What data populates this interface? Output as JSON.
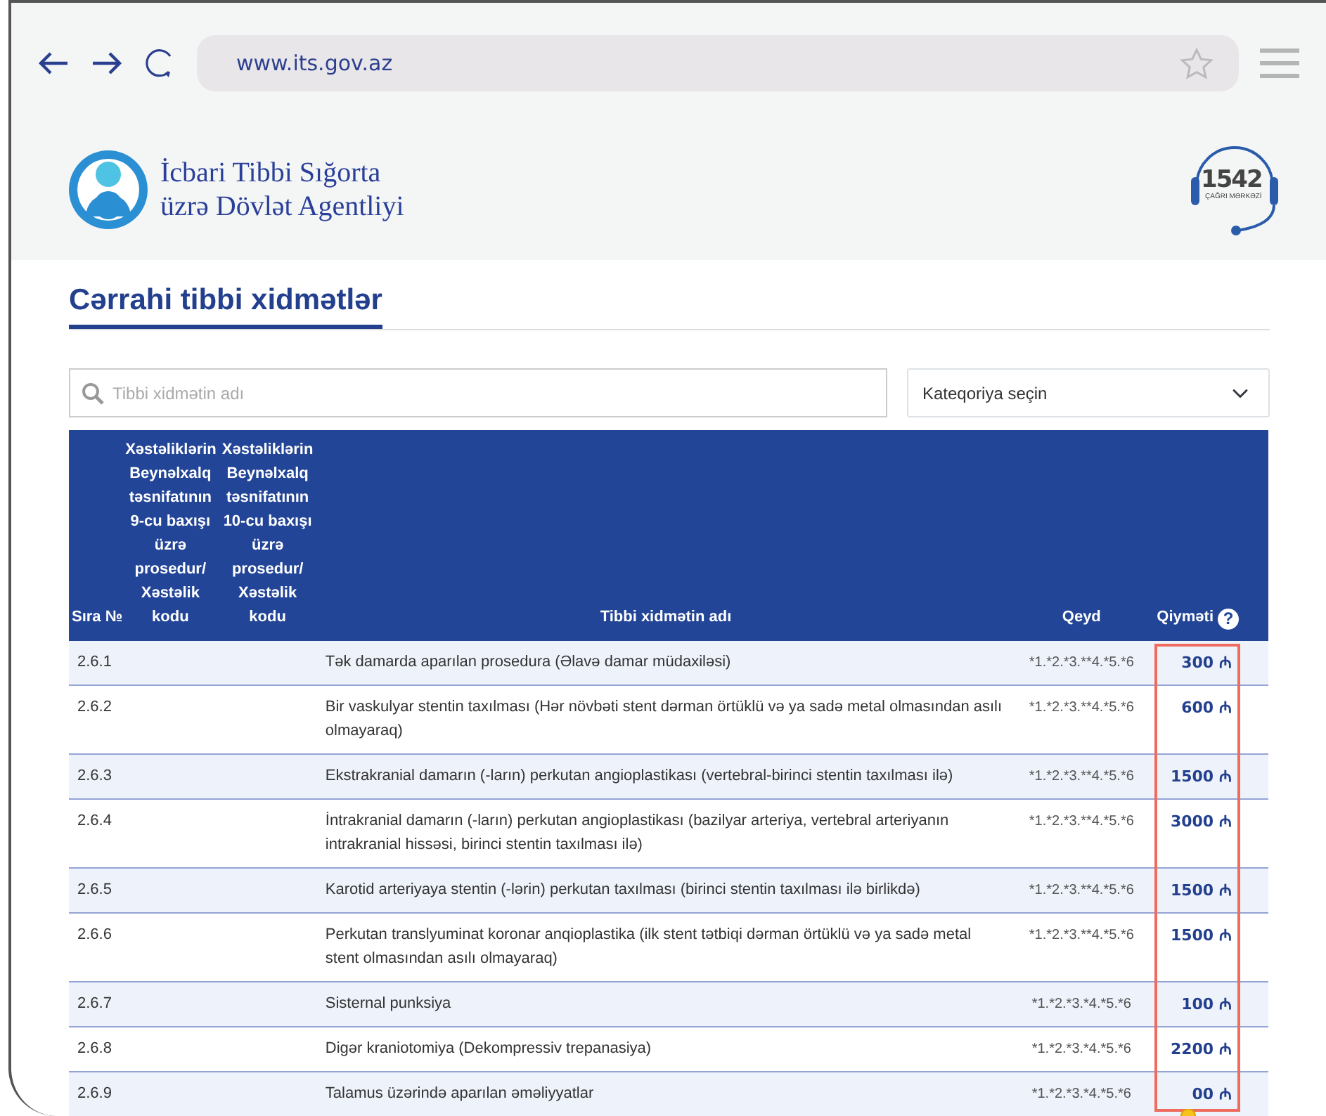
{
  "browser": {
    "url": "www.its.gov.az"
  },
  "site_header": {
    "org_name_lines": [
      "İcbari Tibbi Sığorta",
      "üzrə Dövlət Agentliyi"
    ],
    "hotline": {
      "number": "1542",
      "caption": "ÇAĞRI MƏRKƏZİ"
    }
  },
  "page_title": "Cərrahi tibbi xidmətlər",
  "search": {
    "placeholder": "Tibbi xidmətin adı"
  },
  "category_select": {
    "value": "Kateqoriya seçin"
  },
  "table": {
    "columns": [
      {
        "label": "Sıra №"
      },
      {
        "label": "Xəstəliklərin Beynəlxalq təsnifatının 9-cu baxışı üzrə prosedur/ Xəstəlik kodu"
      },
      {
        "label": "Xəstəliklərin Beynəlxalq təsnifatının 10-cu baxışı üzrə prosedur/ Xəstəlik kodu"
      },
      {
        "label": "Tibbi xidmətin adı"
      },
      {
        "label": "Qeyd"
      },
      {
        "label": "Qiymәti",
        "help": "?"
      }
    ],
    "rows": [
      {
        "no": "2.6.1",
        "name": "Tək damarda aparılan prosedura (Əlavə damar müdaxiləsi)",
        "note": "*1.*2.*3.**4.*5.*6",
        "price": "300 ₼"
      },
      {
        "no": "2.6.2",
        "name": "Bir vaskulyar stentin taxılması (Hər növbəti stent dərman örtüklü və ya sadə metal olmasından asılı olmayaraq)",
        "note": "*1.*2.*3.**4.*5.*6",
        "price": "600 ₼"
      },
      {
        "no": "2.6.3",
        "name": "Ekstrakranial damarın (-ların) perkutan angioplastikası (vertebral-birinci stentin taxılması ilə)",
        "note": "*1.*2.*3.**4.*5.*6",
        "price": "1500 ₼"
      },
      {
        "no": "2.6.4",
        "name": "İntrakranial damarın (-ların) perkutan angioplastikası (bazilyar arteriya, vertebral arteriyanın intrakranial hissəsi, birinci stentin taxılması ilə)",
        "note": "*1.*2.*3.**4.*5.*6",
        "price": "3000 ₼"
      },
      {
        "no": "2.6.5",
        "name": "Karotid arteriyaya stentin (-lərin) perkutan taxılması (birinci stentin taxılması ilə birlikdə)",
        "note": "*1.*2.*3.**4.*5.*6",
        "price": "1500 ₼"
      },
      {
        "no": "2.6.6",
        "name": "Perkutan translyuminat koronar anqioplastika (ilk stent tətbiqi dərman örtüklü və ya sadə metal stent olmasından asılı olmayaraq)",
        "note": "*1.*2.*3.**4.*5.*6",
        "price": "1500 ₼"
      },
      {
        "no": "2.6.7",
        "name": "Sisternal punksiya",
        "note": "*1.*2.*3.*4.*5.*6",
        "price": "100 ₼"
      },
      {
        "no": "2.6.8",
        "name": "Digər kraniotomiya (Dekompressiv trepanasiya)",
        "note": "*1.*2.*3.*4.*5.*6",
        "price": "2200 ₼"
      },
      {
        "no": "2.6.9",
        "name": "Talamus üzərində aparılan əməliyyatlar",
        "note": "*1.*2.*3.*4.*5.*6",
        "price": "00 ₼"
      }
    ]
  }
}
